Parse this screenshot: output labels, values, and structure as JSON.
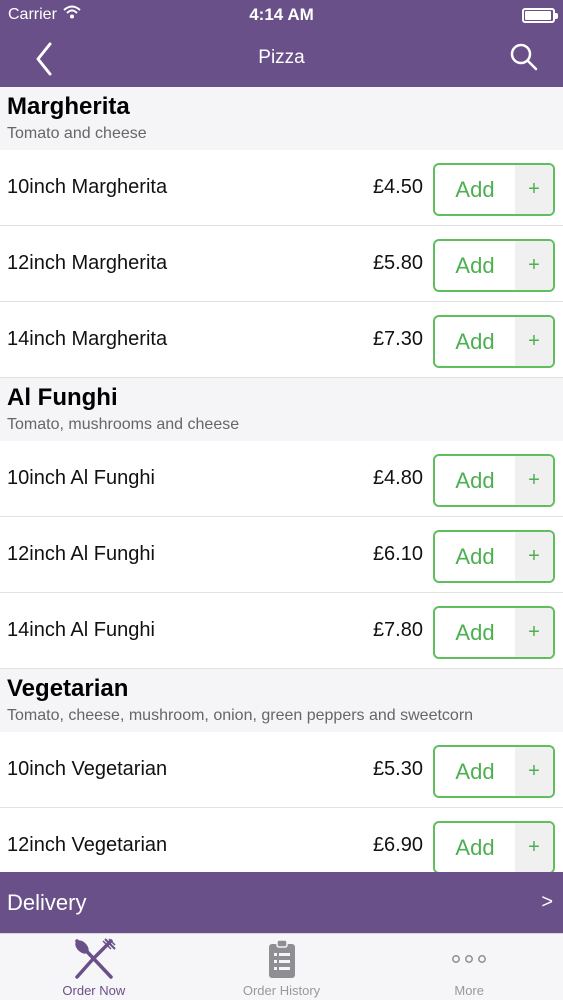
{
  "status_bar": {
    "carrier": "Carrier",
    "time": "4:14 AM"
  },
  "nav": {
    "title": "Pizza",
    "back_icon": "chevron-left-icon",
    "search_icon": "search-icon"
  },
  "colors": {
    "brand": "#6a5088",
    "add_green": "#4caf50",
    "section_bg": "#f5f5f7"
  },
  "sections": [
    {
      "title": "Margherita",
      "description": "Tomato and cheese",
      "items": [
        {
          "name": "10inch Margherita",
          "price": "£4.50",
          "add_label": "Add",
          "plus": "+"
        },
        {
          "name": "12inch Margherita",
          "price": "£5.80",
          "add_label": "Add",
          "plus": "+"
        },
        {
          "name": "14inch Margherita",
          "price": "£7.30",
          "add_label": "Add",
          "plus": "+"
        }
      ]
    },
    {
      "title": "Al Funghi",
      "description": "Tomato, mushrooms and cheese",
      "items": [
        {
          "name": "10inch Al Funghi",
          "price": "£4.80",
          "add_label": "Add",
          "plus": "+"
        },
        {
          "name": "12inch Al Funghi",
          "price": "£6.10",
          "add_label": "Add",
          "plus": "+"
        },
        {
          "name": "14inch Al Funghi",
          "price": "£7.80",
          "add_label": "Add",
          "plus": "+"
        }
      ]
    },
    {
      "title": "Vegetarian",
      "description": "Tomato, cheese, mushroom, onion, green peppers and sweetcorn",
      "items": [
        {
          "name": "10inch Vegetarian",
          "price": "£5.30",
          "add_label": "Add",
          "plus": "+"
        },
        {
          "name": "12inch Vegetarian",
          "price": "£6.90",
          "add_label": "Add",
          "plus": "+"
        }
      ]
    }
  ],
  "delivery": {
    "label": "Delivery",
    "chevron": ">"
  },
  "tabs": [
    {
      "label": "Order Now",
      "icon": "fork-knife-icon",
      "active": true
    },
    {
      "label": "Order History",
      "icon": "clipboard-list-icon",
      "active": false
    },
    {
      "label": "More",
      "icon": "more-dots-icon",
      "active": false
    }
  ]
}
